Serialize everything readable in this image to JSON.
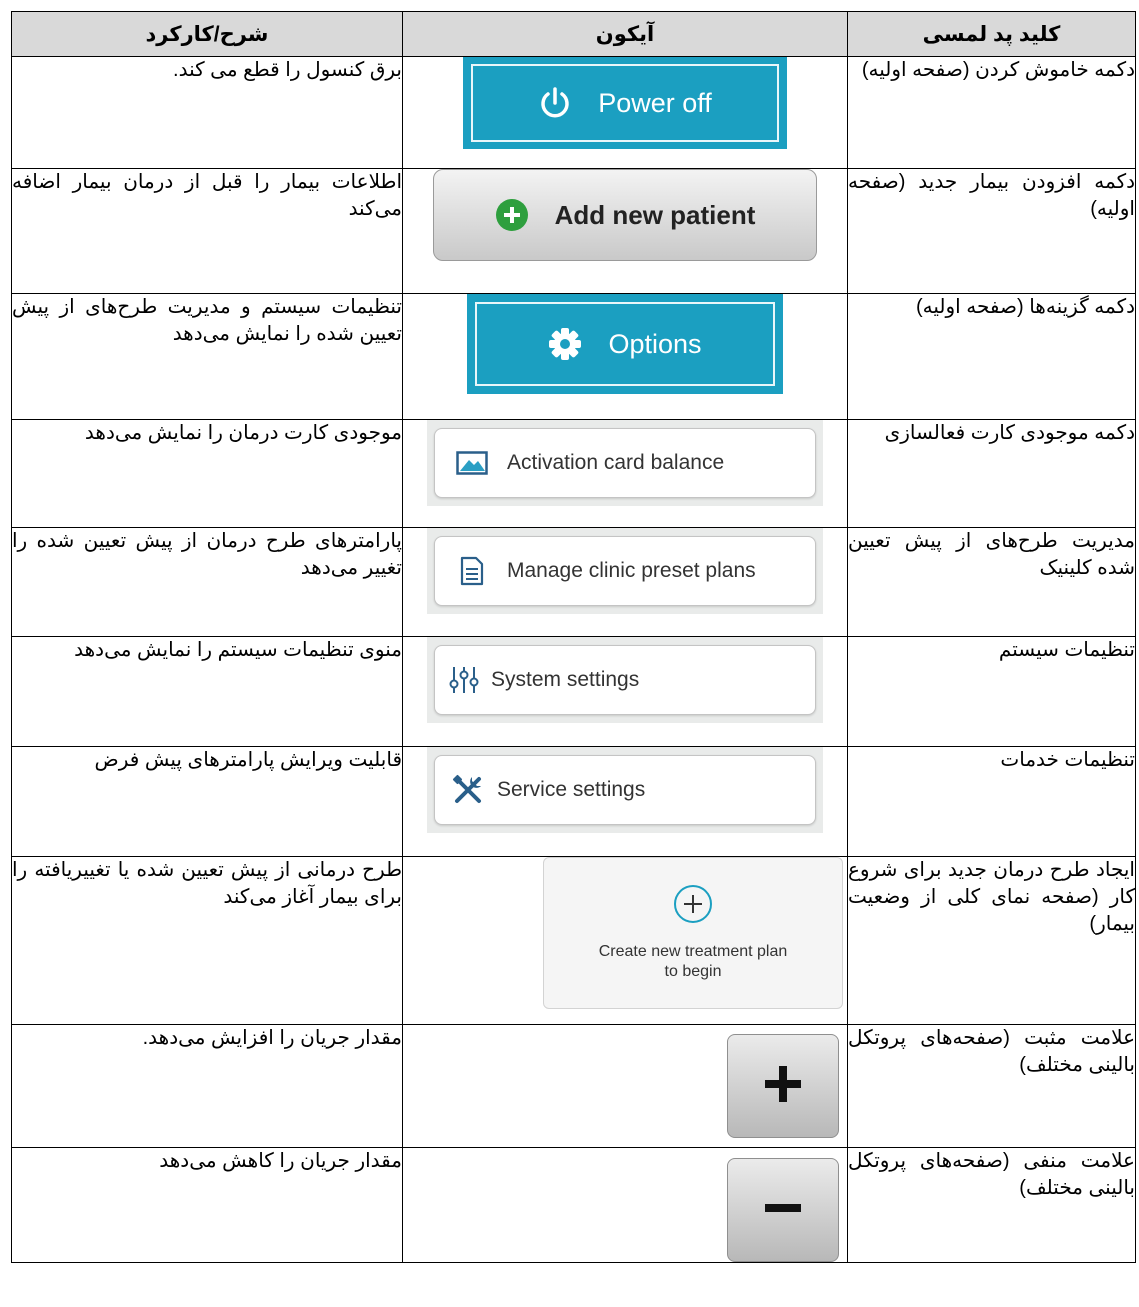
{
  "header": {
    "desc": "شرح/کارکرد",
    "icon": "آیکون",
    "key": "کلید پد لمسی"
  },
  "rows": [
    {
      "desc": "برق کنسول را قطع می کند.",
      "key": "دکمه خاموش کردن (صفحه اولیه)",
      "button_label": "Power off",
      "icon_name": "power-icon"
    },
    {
      "desc": "اطلاعات بیمار را قبل از درمان بیمار اضافه می‌کند",
      "key": "دکمه افزودن بیمار جدید (صفحه اولیه)",
      "button_label": "Add new patient",
      "icon_name": "plus-circle-icon"
    },
    {
      "desc": "تنظیمات سیستم و مدیریت طرح‌های از پیش تعیین شده را نمایش می‌دهد",
      "key": "دکمه گزینه‌ها (صفحه اولیه)",
      "button_label": "Options",
      "icon_name": "gear-icon"
    },
    {
      "desc": "موجودی کارت درمان را نمایش می‌دهد",
      "key": "دکمه موجودی کارت فعالسازی",
      "button_label": "Activation card balance",
      "icon_name": "card-icon"
    },
    {
      "desc": "پارامترهای طرح درمان از پیش تعیین شده را تغییر می‌دهد",
      "key": "مدیریت طرح‌های از پیش تعیین شده کلینیک",
      "button_label": "Manage clinic preset plans",
      "icon_name": "document-icon"
    },
    {
      "desc": "منوی تنظیمات سیستم را نمایش می‌دهد",
      "key": "تنظیمات سیستم",
      "button_label": "System settings",
      "icon_name": "sliders-icon"
    },
    {
      "desc": "قابلیت ویرایش پارامترهای پیش فرض",
      "key": "تنظیمات خدمات",
      "button_label": "Service settings",
      "icon_name": "tools-icon"
    },
    {
      "desc": "طرح درمانی از پیش تعیین شده یا تغییریافته را برای بیمار آغاز می‌کند",
      "key": "ایجاد طرح درمان جدید برای شروع کار (صفحه نمای کلی از وضعیت بیمار)",
      "button_label": "Create new treatment plan to begin",
      "icon_name": "plus-circle-outline-icon"
    },
    {
      "desc": "مقدار جریان را افزایش می‌دهد.",
      "key": "علامت مثبت (صفحه‌های پروتکل بالینی مختلف)",
      "button_label": "",
      "icon_name": "plus-icon"
    },
    {
      "desc": "مقدار جریان را کاهش می‌دهد",
      "key": "علامت منفی (صفحه‌های پروتکل بالینی مختلف)",
      "button_label": "",
      "icon_name": "minus-icon"
    }
  ],
  "colors": {
    "blue": "#1b9fc1",
    "header_bg": "#d9d9d9",
    "green": "#2e9f3e"
  }
}
